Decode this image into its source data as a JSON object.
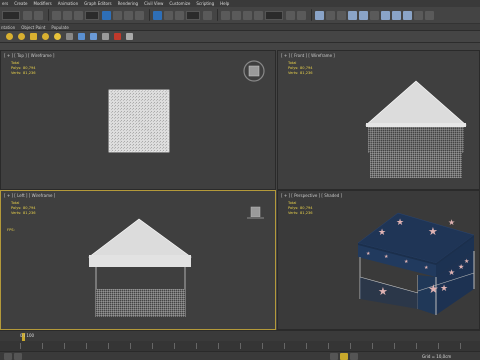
{
  "menu": {
    "items": [
      "ers",
      "Create",
      "Modifiers",
      "Animation",
      "Graph Editors",
      "Rendering",
      "Civil View",
      "Customize",
      "Scripting",
      "Help"
    ]
  },
  "ribbon": {
    "tabs": [
      "ntation",
      "Object Paint",
      "Populate"
    ]
  },
  "viewports": {
    "top": {
      "label": "[ + ] [ Top ] [ Wireframe ]"
    },
    "front": {
      "label": "[ + ] [ Front ] [ Wireframe ]"
    },
    "left": {
      "label": "[ + ] [ Left ] [ Wireframe ]"
    },
    "perspective": {
      "label": "[ + ] [ Perspective ] [ Shaded ]"
    }
  },
  "stats": {
    "total_label": "Total",
    "polys_label": "Polys:",
    "polys_value": "80,794",
    "verts_label": "Verts:",
    "verts_value": "81,236",
    "fps_label": "FPS:"
  },
  "timeline": {
    "frame_counter": "0 / 100"
  },
  "status": {
    "grid_readout": "Grid = 10,0cm"
  },
  "colors": {
    "viewport_bg": "#3f3f3f",
    "active_border": "#b49a3a",
    "stats_text": "#e8d04a",
    "tent_canopy": "#1f3556",
    "star": "#e0b3b3"
  },
  "icons": {
    "toolbar_main": [
      "undo-icon",
      "redo-icon",
      "link-icon",
      "unlink-icon",
      "bind-space-warp-icon",
      "selection-filter-dropdown",
      "select-object-icon",
      "select-by-name-icon",
      "rectangle-selection-icon",
      "window-crossing-icon",
      "select-move-icon",
      "select-rotate-icon",
      "select-scale-icon",
      "reference-coordinate-dropdown",
      "pivot-icon",
      "snaps-toggle-icon",
      "angle-snap-icon",
      "percent-snap-icon",
      "spinner-snap-icon",
      "named-selection-dropdown",
      "mirror-icon",
      "align-icon",
      "layer-explorer-icon",
      "scene-explorer-icon",
      "curve-editor-icon",
      "schematic-view-icon",
      "material-editor-icon",
      "render-setup-icon",
      "rendered-frame-window-icon",
      "render-production-icon",
      "render-iterative-icon",
      "render-cloud-icon",
      "a360-icon"
    ],
    "toolbar_secondary": [
      "sphere-icon",
      "cone-icon",
      "box-icon",
      "teapot-icon",
      "light-icon",
      "camera-icon",
      "helper-icon",
      "spacewarp-icon",
      "system-icon",
      "bone-icon",
      "shapes-icon"
    ]
  }
}
